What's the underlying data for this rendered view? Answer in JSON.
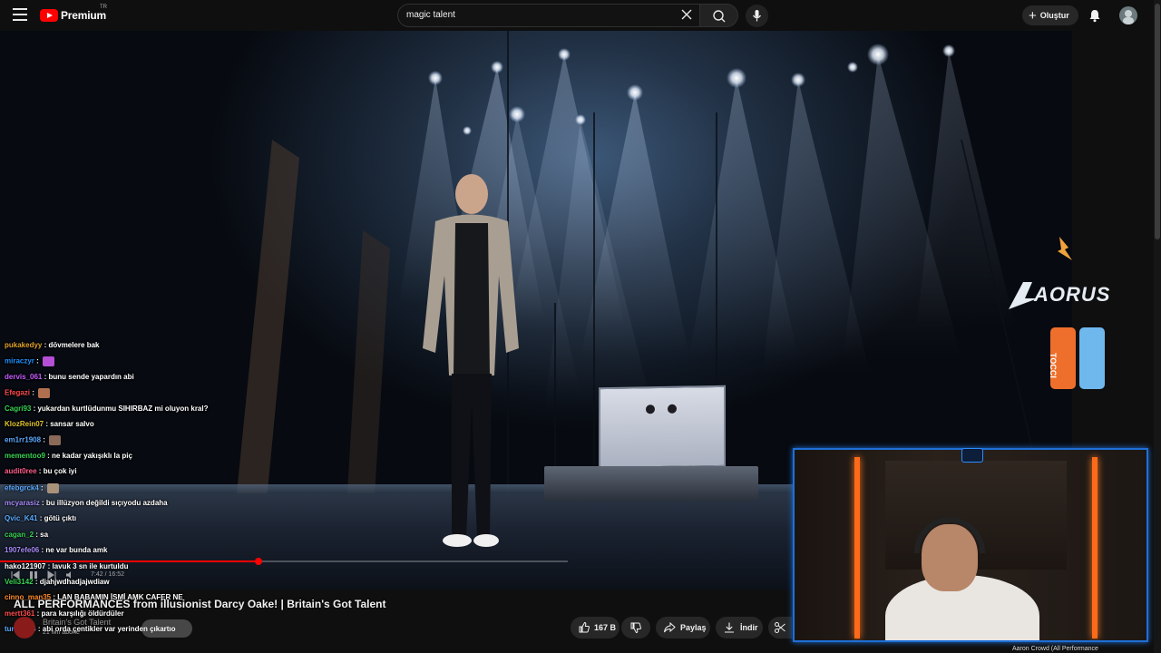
{
  "topbar": {
    "logo_text": "Premium",
    "country_code": "TR",
    "search_value": "magic talent",
    "create_label": "Oluştur"
  },
  "chat": [
    {
      "user": "pukakedyy",
      "user_color": "#e0a02c",
      "message": "dövmelere bak",
      "emote": false
    },
    {
      "user": "miraczyr",
      "user_color": "#1e90ff",
      "message": "",
      "emote": true,
      "emote_color": "#b44fd6"
    },
    {
      "user": "dervis_061",
      "user_color": "#c75bff",
      "message": "bunu sende yapardın abi",
      "emote": false
    },
    {
      "user": "Efegazi",
      "user_color": "#ff4b4b",
      "message": "",
      "emote": true,
      "emote_color": "#b07050"
    },
    {
      "user": "Cagri93",
      "user_color": "#39d353",
      "message": "yukardan kurtlüdunmu SIHIRBAZ mi oluyon kral?",
      "emote": false
    },
    {
      "user": "KlozRein07",
      "user_color": "#e0c22c",
      "message": "sansar salvo",
      "emote": false
    },
    {
      "user": "em1rr1908",
      "user_color": "#5aa9ff",
      "message": "",
      "emote": true,
      "emote_color": "#8a6a58"
    },
    {
      "user": "mementoo9",
      "user_color": "#39d353",
      "message": "ne kadar yakışıklı la piç",
      "emote": false
    },
    {
      "user": "audit0ree",
      "user_color": "#ff5c8a",
      "message": "bu çok iyi",
      "emote": false
    },
    {
      "user": "efebgrck4",
      "user_color": "#5aa9ff",
      "message": "",
      "emote": true,
      "emote_color": "#a9927a"
    },
    {
      "user": "mcyarasiz",
      "user_color": "#a78bfa",
      "message": "bu illüzyon değildi sıçıyodu azdaha",
      "emote": false
    },
    {
      "user": "Qvic_K41",
      "user_color": "#5aa9ff",
      "message": "götü çıktı",
      "emote": false
    },
    {
      "user": "cagan_2",
      "user_color": "#39d353",
      "message": "sa",
      "emote": false
    },
    {
      "user": "1907efe06",
      "user_color": "#a78bfa",
      "message": "ne var bunda amk",
      "emote": false
    },
    {
      "user": "hako121907",
      "user_color": "#ffffff",
      "message": "lavuk 3 sn ile kurtuldu",
      "emote": false
    },
    {
      "user": "Veli3142",
      "user_color": "#39d353",
      "message": "djahjwdhadjajwdiaw",
      "emote": false
    },
    {
      "user": "cinno_man35",
      "user_color": "#ff8c2c",
      "message": "LAN BABAMIN İSMİ AMK CAFER NE",
      "emote": false
    },
    {
      "user": "mertt361",
      "user_color": "#ff4b4b",
      "message": "para karşılığı öldürdüler",
      "emote": false
    },
    {
      "user": "tuna0606",
      "user_color": "#5aa9ff",
      "message": "abi orda çentikler var yerinden çıkartıo",
      "emote": false
    }
  ],
  "video": {
    "title": "ALL PERFORMANCES from illusionist Darcy Oake! | Britain's Got Talent",
    "time": "7:42 / 16:52",
    "progress": 0.455,
    "channel_name": "Britain's Got Talent",
    "channel_subs": "21 Mn abone"
  },
  "actions": {
    "like_count": "167 B",
    "share_label": "Paylaş",
    "download_label": "İndir"
  },
  "sponsor": {
    "brand": "AORUS",
    "can_text": "TOCCI"
  },
  "webcam": {
    "caption": "Aaron Crowd (All Performance"
  }
}
